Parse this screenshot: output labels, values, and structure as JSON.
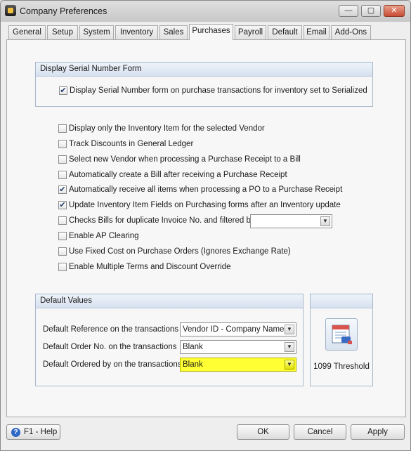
{
  "window": {
    "title": "Company Preferences",
    "minimize_glyph": "—",
    "restore_glyph": "▢",
    "close_glyph": "✕"
  },
  "tabs": [
    {
      "label": "General"
    },
    {
      "label": "Setup"
    },
    {
      "label": "System"
    },
    {
      "label": "Inventory"
    },
    {
      "label": "Sales"
    },
    {
      "label": "Purchases",
      "active": true
    },
    {
      "label": "Payroll"
    },
    {
      "label": "Default"
    },
    {
      "label": "Email"
    },
    {
      "label": "Add-Ons"
    }
  ],
  "serial_group": {
    "title": "Display Serial Number Form",
    "option": {
      "label": "Display Serial Number form on purchase transactions for inventory set to Serialized",
      "checked": true
    }
  },
  "options": [
    {
      "label": "Display only the Inventory Item for the selected Vendor",
      "checked": false
    },
    {
      "label": "Track Discounts in General Ledger",
      "checked": false
    },
    {
      "label": "Select new Vendor when processing a Purchase Receipt to a Bill",
      "checked": false
    },
    {
      "label": "Automatically create a Bill after receiving a Purchase Receipt",
      "checked": false
    },
    {
      "label": "Automatically receive all items when processing a PO to a Purchase Receipt",
      "checked": true
    },
    {
      "label": "Update Inventory Item Fields on Purchasing forms after an Inventory update",
      "checked": true
    },
    {
      "label": "Checks Bills for duplicate Invoice No. and filtered by:",
      "checked": false
    },
    {
      "label": "Enable AP Clearing",
      "checked": false
    },
    {
      "label": "Use Fixed Cost on Purchase Orders (Ignores Exchange Rate)",
      "checked": false
    },
    {
      "label": "Enable Multiple Terms and Discount Override",
      "checked": false
    }
  ],
  "duplicate_filter": {
    "value": ""
  },
  "defaults_group": {
    "title": "Default Values",
    "rows": [
      {
        "label": "Default Reference on the transactions",
        "value": "Vendor ID - Company Name"
      },
      {
        "label": "Default Order No. on the transactions",
        "value": "Blank"
      },
      {
        "label": "Default Ordered by on the transactions",
        "value": "Blank",
        "highlighted": true
      }
    ]
  },
  "threshold": {
    "label": "1099 Threshold",
    "icon": "calendar-doc-icon"
  },
  "footer": {
    "help_label": "F1 - Help",
    "ok_label": "OK",
    "cancel_label": "Cancel",
    "apply_label": "Apply"
  },
  "check_glyph": "✔",
  "arrow_glyph": "▼",
  "help_glyph": "?",
  "colors": {
    "highlight": "#ffff33",
    "group_header": "#d6e1ef",
    "check": "#1f3c66"
  }
}
